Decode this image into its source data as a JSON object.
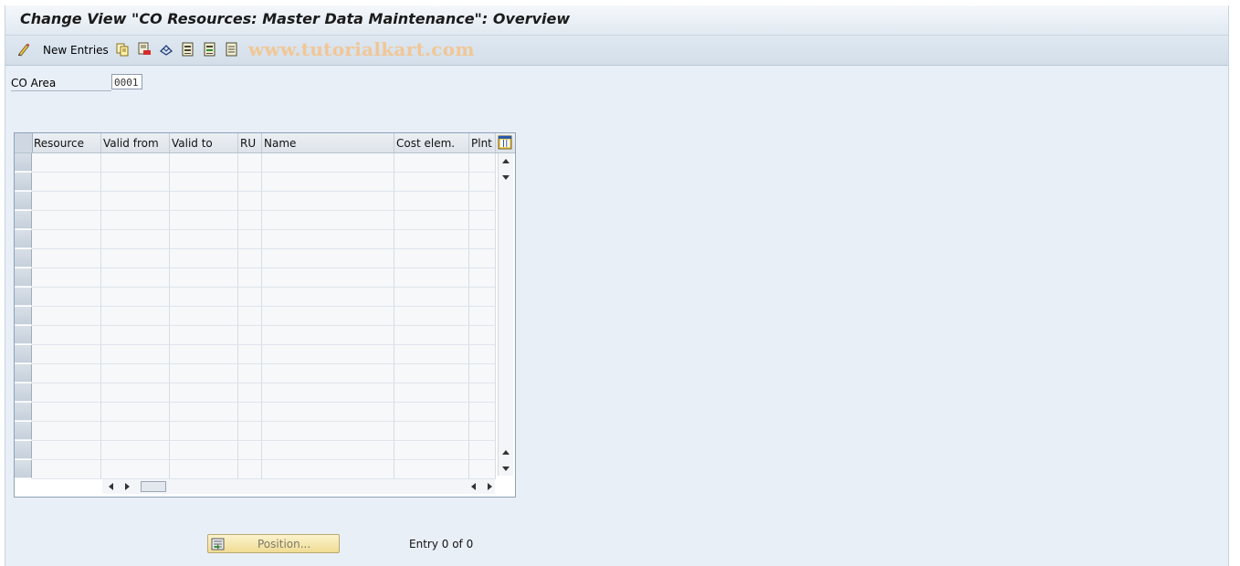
{
  "window": {
    "title": "Change View \"CO Resources: Master Data Maintenance\": Overview"
  },
  "toolbar": {
    "new_entries_label": "New Entries",
    "icons": [
      "edit-glasses-icon",
      "copy-icon",
      "delete-icon",
      "undo-change-icon",
      "select-all-icon",
      "select-block-icon",
      "deselect-all-icon"
    ],
    "watermark": "www.tutorialkart.com"
  },
  "filter": {
    "co_area_label": "CO Area",
    "co_area_value": "0001"
  },
  "table": {
    "columns": [
      "Resource",
      "Valid from",
      "Valid to",
      "RU",
      "Name",
      "Cost elem.",
      "Plnt"
    ],
    "row_count": 17,
    "rows": []
  },
  "footer": {
    "position_button_label": "Position...",
    "entry_status": "Entry 0 of 0"
  }
}
